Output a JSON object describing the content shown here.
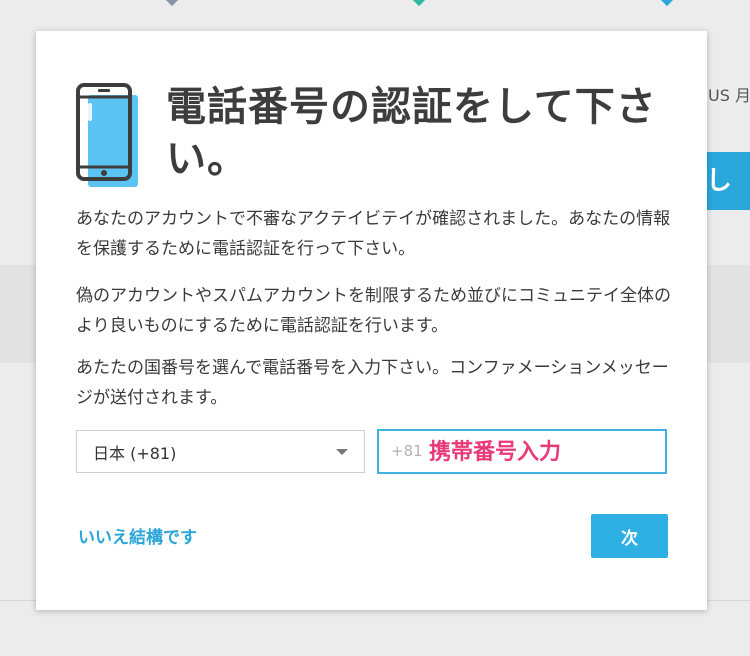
{
  "background": {
    "right_text": "US 月",
    "button_glyph": "し",
    "marker_colors": [
      "#8a93a6",
      "#2cb8a0",
      "#2aa8dc"
    ]
  },
  "dialog": {
    "title": "電話番号の認証をして下さい。",
    "paragraphs": [
      "あなたのアカウントで不審なアクテイビテイが確認されました。あなたの情報を保護するために電話認証を行って下さい。",
      "偽のアカウントやスパムアカウントを制限するため並びにコミュニテイ全体のより良いものにするために電話認証を行います。",
      "あたたの国番号を選んで電話番号を入力下さい。コンファメーションメッセージが送付されます。"
    ],
    "country_select": {
      "value": "日本 (+81)"
    },
    "phone_input": {
      "prefix": "+81",
      "value": "",
      "annotation": "携帯番号入力"
    },
    "no_thanks_label": "いいえ結構です",
    "next_label": "次"
  },
  "colors": {
    "accent": "#2fb0e3",
    "annotation": "#e83a77",
    "phone_icon_fill": "#5bc4f2"
  },
  "icons": {
    "dialog_icon": "smartphone-icon"
  }
}
